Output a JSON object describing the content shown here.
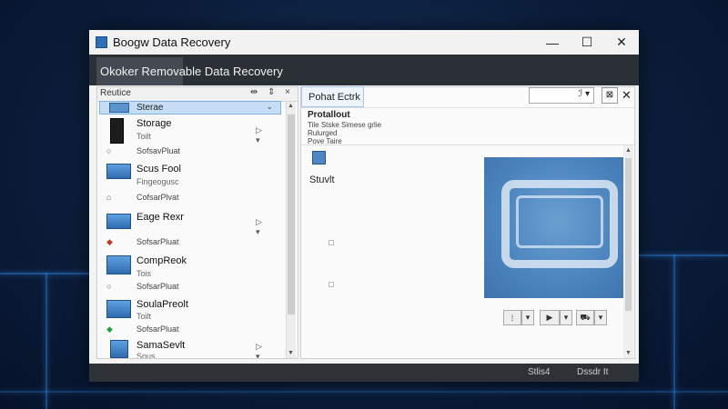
{
  "window": {
    "title": "Boogw Data Recovery",
    "controls": {
      "minimize": "—",
      "maximize": "☐",
      "close": "✕"
    }
  },
  "tabbar": {
    "active_tab": "Okoker Removable Data Recovery"
  },
  "left_panel": {
    "title": "Reutice",
    "tools": "⇹ ⇕ ×",
    "selected": {
      "label": "Sterae",
      "chevron": "⌄"
    },
    "items": [
      {
        "name": "Storage",
        "sub": "Toilt",
        "status": "SofsavPluat",
        "status_icon": "○",
        "actions": "▷ ▾",
        "icon": "phone-device-icon"
      },
      {
        "name": "Scus Fool",
        "sub": "Fingeogusc",
        "status": "CofsarPlvat",
        "status_icon": "⌂",
        "actions": "",
        "icon": "drive-icon"
      },
      {
        "name": "Eage Rexr",
        "sub": "",
        "status": "SofsarPluat",
        "status_icon": "◆",
        "actions": "▷ ▾",
        "icon": "drive-icon"
      },
      {
        "name": "CompReok",
        "sub": "Tois",
        "status": "SofsarPluat",
        "status_icon": "○",
        "actions": "",
        "icon": "laptop-icon"
      },
      {
        "name": "SoulaPreolt",
        "sub": "Toilt",
        "status": "SofsarPluat",
        "status_icon": "◆",
        "actions": "",
        "icon": "monitor-icon"
      },
      {
        "name": "SamaSevlt",
        "sub": "Sous",
        "status": "",
        "status_icon": "",
        "actions": "▷ ▾",
        "icon": "drive-icon"
      }
    ]
  },
  "right_panel": {
    "tab_label": "Pohat Ectrk",
    "search_placeholder": "",
    "search_icon": "ℐ ▾",
    "filter_icon": "⊠",
    "close": "✕",
    "properties": {
      "title": "Protallout",
      "lines": [
        "Tile Stske Simese grlie",
        "Rulurged",
        "Pove Taire"
      ]
    },
    "preview_label": "Stuvlt",
    "controls": [
      {
        "a": "⁞",
        "b": "▾"
      },
      {
        "a": "▶",
        "b": "▾"
      },
      {
        "a": "⛟",
        "b": "▾"
      }
    ]
  },
  "statusbar": {
    "left": "Stlis4",
    "right": "Dssdr It"
  },
  "colors": {
    "accent": "#2e6fb5",
    "tabbar": "#2b2f36",
    "selection": "#c5def5"
  }
}
